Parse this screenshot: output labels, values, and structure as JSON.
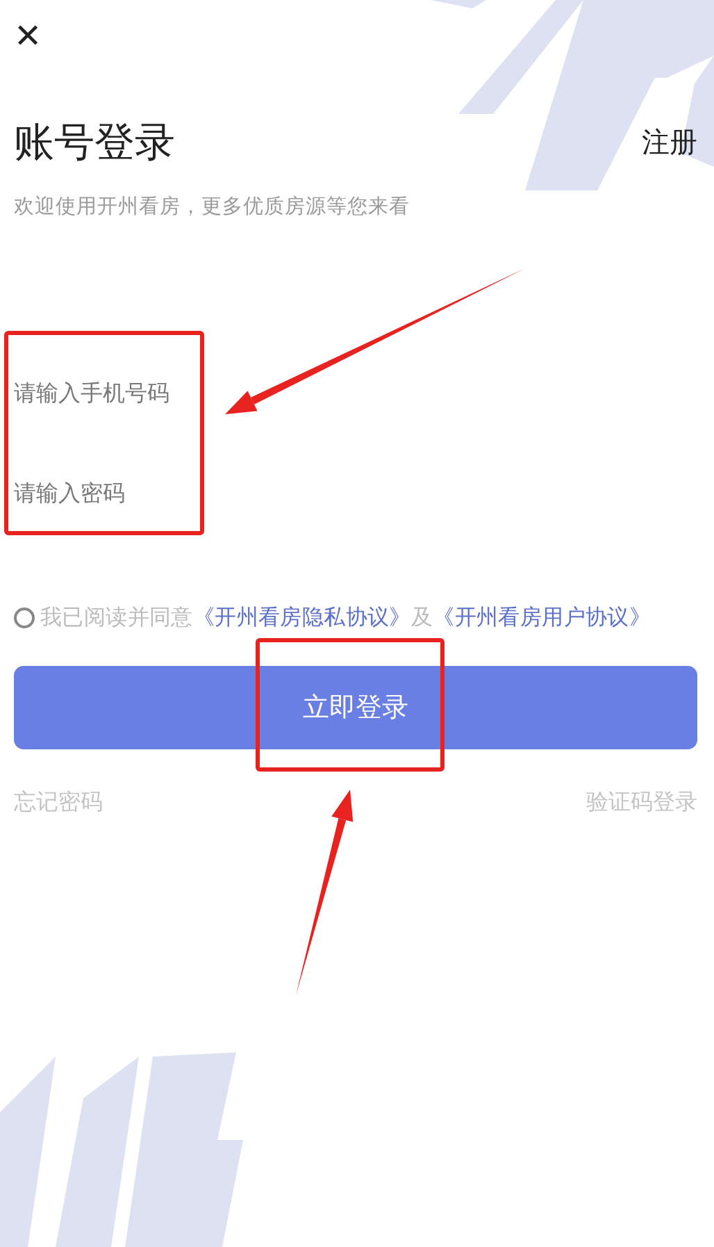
{
  "close": {
    "glyph": "✕"
  },
  "title": "账号登录",
  "register": "注册",
  "subtitle": "欢迎使用开州看房，更多优质房源等您来看",
  "fields": [
    {
      "placeholder": "请输入手机号码"
    },
    {
      "placeholder": "请输入密码"
    }
  ],
  "agreement": {
    "checked": false,
    "prefix": "我已阅读并同意",
    "joiner": "及",
    "links": [
      "《开州看房隐私协议》",
      "《开州看房用户协议》"
    ]
  },
  "login_button": "立即登录",
  "footer_links": [
    "忘记密码",
    "验证码登录"
  ],
  "annotations": [
    {
      "kind": "frame"
    },
    {
      "kind": "frame"
    },
    {
      "kind": "arrow"
    },
    {
      "kind": "arrow"
    }
  ]
}
